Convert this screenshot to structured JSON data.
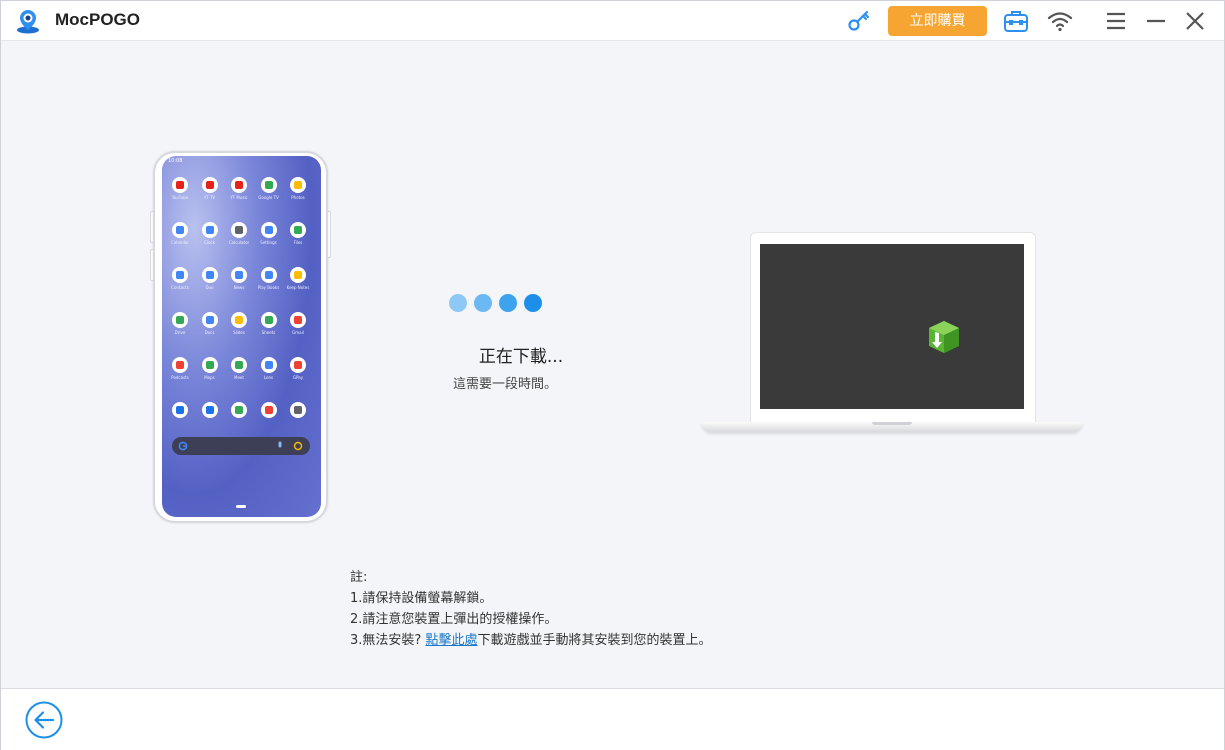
{
  "app": {
    "title": "MocPOGO"
  },
  "header": {
    "buy_label": "立即購買"
  },
  "icons": {
    "logo": "location-pin-logo-icon",
    "key": "key-icon",
    "toolbox": "toolbox-icon",
    "wifi": "wifi-icon",
    "menu": "hamburger-menu-icon",
    "minimize": "minimize-icon",
    "close": "close-icon",
    "back": "back-arrow-icon",
    "package": "package-download-icon"
  },
  "colors": {
    "accent": "#f6a532",
    "primary": "#1e8fe8",
    "link": "#1a78c9"
  },
  "phone": {
    "status_time": "10:08",
    "apps": [
      {
        "label": "YouTube",
        "color": "#e62117"
      },
      {
        "label": "YT TV",
        "color": "#e62117"
      },
      {
        "label": "YT Music",
        "color": "#e62117"
      },
      {
        "label": "Google TV",
        "color": "#34a853"
      },
      {
        "label": "Photos",
        "color": "#fbbc04"
      },
      {
        "label": "Calendar",
        "color": "#4285f4"
      },
      {
        "label": "Clock",
        "color": "#4285f4"
      },
      {
        "label": "Calculator",
        "color": "#5f6368"
      },
      {
        "label": "Settings",
        "color": "#4285f4"
      },
      {
        "label": "Files",
        "color": "#34a853"
      },
      {
        "label": "Contacts",
        "color": "#4285f4"
      },
      {
        "label": "Duo",
        "color": "#4285f4"
      },
      {
        "label": "News",
        "color": "#4285f4"
      },
      {
        "label": "Play Books",
        "color": "#4285f4"
      },
      {
        "label": "Keep Notes",
        "color": "#fbbc04"
      },
      {
        "label": "Drive",
        "color": "#34a853"
      },
      {
        "label": "Docs",
        "color": "#4285f4"
      },
      {
        "label": "Slides",
        "color": "#fbbc04"
      },
      {
        "label": "Sheets",
        "color": "#34a853"
      },
      {
        "label": "Gmail",
        "color": "#ea4335"
      },
      {
        "label": "Podcasts",
        "color": "#ea4335"
      },
      {
        "label": "Maps",
        "color": "#34a853"
      },
      {
        "label": "Meet",
        "color": "#34a853"
      },
      {
        "label": "Lens",
        "color": "#4285f4"
      },
      {
        "label": "GPay",
        "color": "#ea4335"
      },
      {
        "label": "",
        "color": "#1a73e8"
      },
      {
        "label": "",
        "color": "#1a73e8"
      },
      {
        "label": "",
        "color": "#34a853"
      },
      {
        "label": "",
        "color": "#ea4335"
      },
      {
        "label": "",
        "color": "#5f6368"
      }
    ]
  },
  "progress": {
    "title": "正在下載...",
    "subtitle": "這需要一段時間。",
    "dot_colors": [
      "#8ec9f5",
      "#6cb8f2",
      "#3ea3ee",
      "#1e8fe8"
    ]
  },
  "notes": {
    "heading": "註:",
    "line1": "1.請保持設備螢幕解鎖。",
    "line2": "2.請注意您裝置上彈出的授權操作。",
    "line3_prefix": "3.無法安裝?",
    "line3_link": "點擊此處",
    "line3_suffix": "下載遊戲並手動將其安裝到您的裝置上。"
  }
}
